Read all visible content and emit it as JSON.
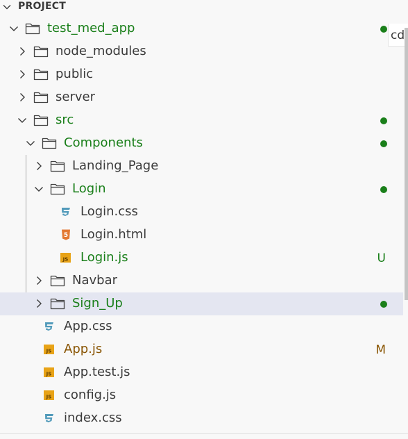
{
  "explorer": {
    "section_title": "PROJECT",
    "terminal_tab_label": "cd"
  },
  "colors": {
    "added_green": "#1a7f1a",
    "modified_brown": "#895503",
    "default_text": "#3b3b3b",
    "css_icon_blue": "#519aba",
    "js_icon_yellow": "#e8a317",
    "html_icon_orange": "#e37933",
    "selected_bg": "#e4e6f1"
  },
  "tree": {
    "rows": [
      {
        "label": "test_med_app",
        "kind": "folder",
        "expanded": true,
        "status": "dot"
      },
      {
        "label": "node_modules",
        "kind": "folder",
        "expanded": false,
        "status": ""
      },
      {
        "label": "public",
        "kind": "folder",
        "expanded": false,
        "status": ""
      },
      {
        "label": "server",
        "kind": "folder",
        "expanded": false,
        "status": ""
      },
      {
        "label": "src",
        "kind": "folder",
        "expanded": true,
        "status": "dot"
      },
      {
        "label": "Components",
        "kind": "folder",
        "expanded": true,
        "status": "dot"
      },
      {
        "label": "Landing_Page",
        "kind": "folder",
        "expanded": false,
        "status": ""
      },
      {
        "label": "Login",
        "kind": "folder",
        "expanded": true,
        "status": "dot"
      },
      {
        "label": "Login.css",
        "kind": "css",
        "status": ""
      },
      {
        "label": "Login.html",
        "kind": "html",
        "status": ""
      },
      {
        "label": "Login.js",
        "kind": "js",
        "status": "U"
      },
      {
        "label": "Navbar",
        "kind": "folder",
        "expanded": false,
        "status": ""
      },
      {
        "label": "Sign_Up",
        "kind": "folder",
        "expanded": false,
        "status": "dot",
        "selected": true
      },
      {
        "label": "App.css",
        "kind": "css",
        "status": ""
      },
      {
        "label": "App.js",
        "kind": "js",
        "status": "M"
      },
      {
        "label": "App.test.js",
        "kind": "js",
        "status": ""
      },
      {
        "label": "config.js",
        "kind": "js",
        "status": ""
      },
      {
        "label": "index.css",
        "kind": "css",
        "status": ""
      }
    ]
  }
}
